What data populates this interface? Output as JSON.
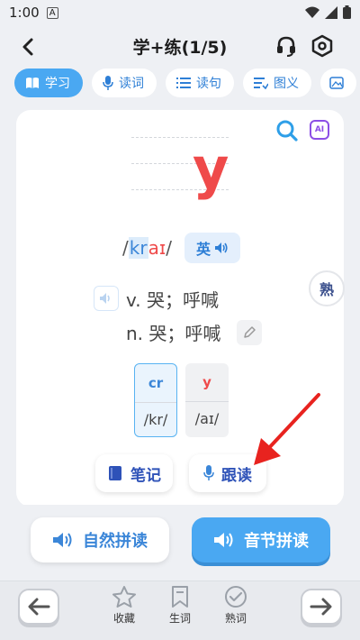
{
  "status_bar": {
    "time": "1:00",
    "sim_label": "A"
  },
  "header": {
    "title": "学+练(1/5)"
  },
  "tabs": [
    {
      "label": "学习",
      "icon": "book-icon",
      "active": true
    },
    {
      "label": "读词",
      "icon": "mic-icon",
      "active": false
    },
    {
      "label": "读句",
      "icon": "list-icon",
      "active": false
    },
    {
      "label": "图义",
      "icon": "image-list-icon",
      "active": false
    }
  ],
  "card": {
    "letter": "y",
    "phonetic": {
      "open": "/",
      "highlight": "kr",
      "rest": "aɪ",
      "close": "/"
    },
    "accent_label": "英",
    "meanings": [
      "v. 哭；呼喊",
      "n. 哭；呼喊"
    ],
    "syllables": [
      {
        "letters": "cr",
        "sound": "/kr/"
      },
      {
        "letters": "y",
        "sound": "/aɪ/"
      }
    ],
    "ai_label": "AI",
    "notes_label": "笔记",
    "follow_label": "跟读"
  },
  "familiar_badge": "熟",
  "bottom": {
    "phonics_label": "自然拼读",
    "syllable_label": "音节拼读"
  },
  "footer": {
    "favorite_label": "收藏",
    "vocab_label": "生词",
    "known_label": "熟词"
  },
  "colors": {
    "accent": "#4aa8f2",
    "brand_blue": "#2e7fd6",
    "letter_red": "#ef4a4a",
    "ai_purple": "#8c4fe6"
  }
}
